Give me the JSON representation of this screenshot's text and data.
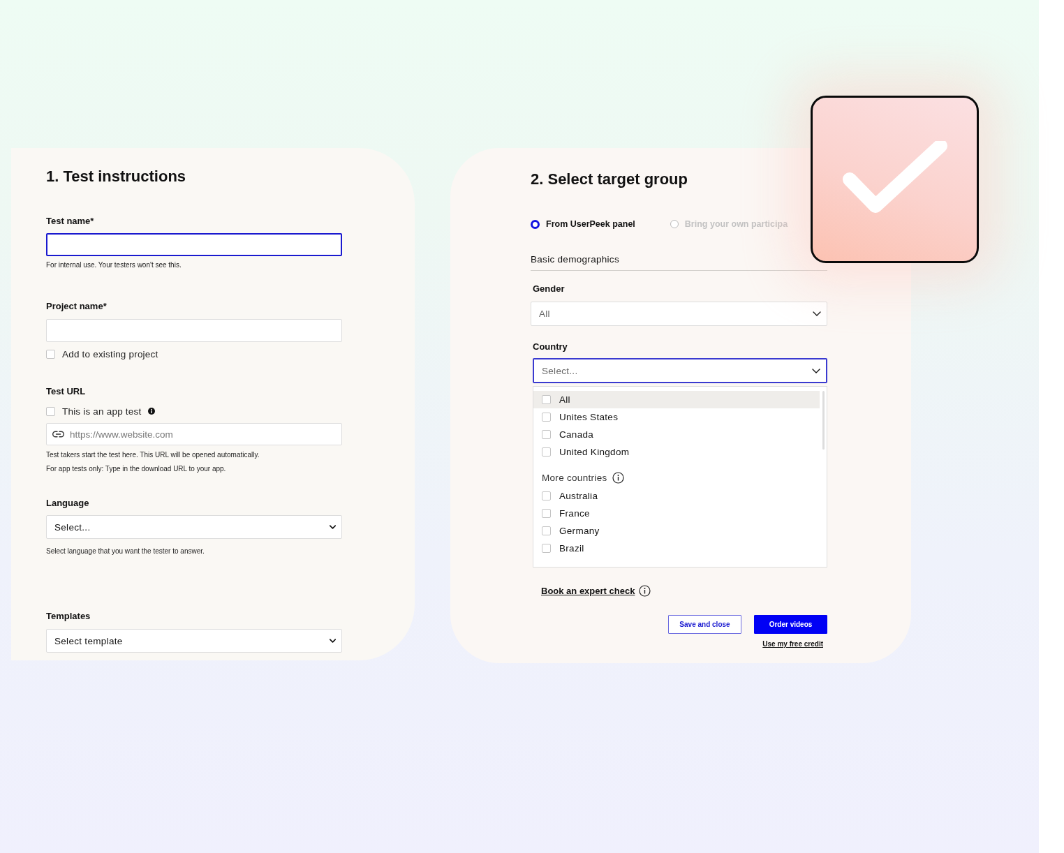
{
  "instructions": {
    "title": "1. Test instructions",
    "fields": [
      {
        "kind": "input",
        "label": "Test name*",
        "focused": true,
        "help": [
          "For internal use. Your testers won't see this."
        ]
      },
      {
        "kind": "input",
        "label": "Project name*",
        "focused": false,
        "checkbox": {
          "label": "Add to existing project",
          "checked": false
        }
      },
      {
        "kind": "url",
        "label": "Test URL",
        "checkbox": {
          "label": "This is an app test",
          "checked": false
        },
        "placeholder": "https://www.website.com",
        "help": [
          "Test takers start the test here. This URL will be opened automatically.",
          "For app tests only: Type in the download URL to your app."
        ]
      },
      {
        "kind": "select",
        "label": "Language",
        "value": "Select...",
        "help": [
          "Select language that you want the tester to answer."
        ]
      },
      {
        "kind": "select",
        "label": "Templates",
        "value": "Select template"
      }
    ]
  },
  "target": {
    "title": "2. Select target group",
    "sources": [
      {
        "label": "From UserPeek panel",
        "selected": true
      },
      {
        "label": "Bring your own participa",
        "selected": false
      }
    ],
    "section": "Basic demographics",
    "gender": {
      "label": "Gender",
      "value": "All"
    },
    "country": {
      "label": "Country",
      "placeholder": "Select...",
      "focused": true,
      "options": [
        {
          "label": "All",
          "checked": false,
          "highlighted": true
        },
        {
          "label": "Unites States",
          "checked": false,
          "highlighted": false
        },
        {
          "label": "Canada",
          "checked": false,
          "highlighted": false
        },
        {
          "label": "United Kingdom",
          "checked": false,
          "highlighted": false
        }
      ],
      "more_label": "More countries",
      "more_options": [
        {
          "label": "Australia",
          "checked": false,
          "highlighted": false
        },
        {
          "label": "France",
          "checked": false,
          "highlighted": false
        },
        {
          "label": "Germany",
          "checked": false,
          "highlighted": false
        },
        {
          "label": "Brazil",
          "checked": false,
          "highlighted": false
        }
      ]
    },
    "expert_link": "Book an expert check",
    "buttons": [
      {
        "label": "Save and close",
        "kind": "secondary"
      },
      {
        "label": "Order videos",
        "kind": "primary"
      }
    ],
    "credit_link": "Use my free credit"
  }
}
